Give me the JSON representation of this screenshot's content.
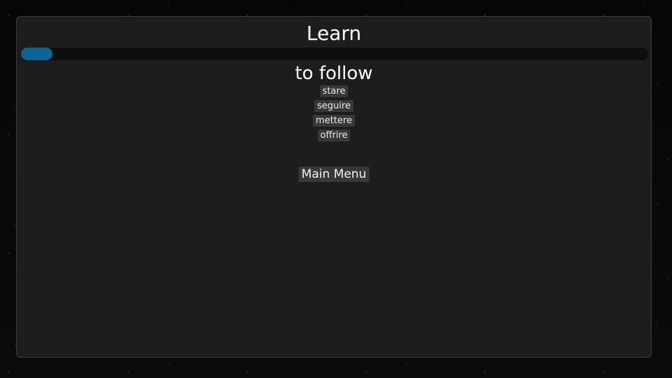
{
  "screen": {
    "title": "Learn"
  },
  "progress": {
    "value_fraction": 0.05,
    "color": "#0a6596"
  },
  "quiz": {
    "prompt": "to follow",
    "options": [
      {
        "label": "stare"
      },
      {
        "label": "seguire"
      },
      {
        "label": "mettere"
      },
      {
        "label": "offrire"
      }
    ]
  },
  "navigation": {
    "main_menu_label": "Main Menu"
  }
}
